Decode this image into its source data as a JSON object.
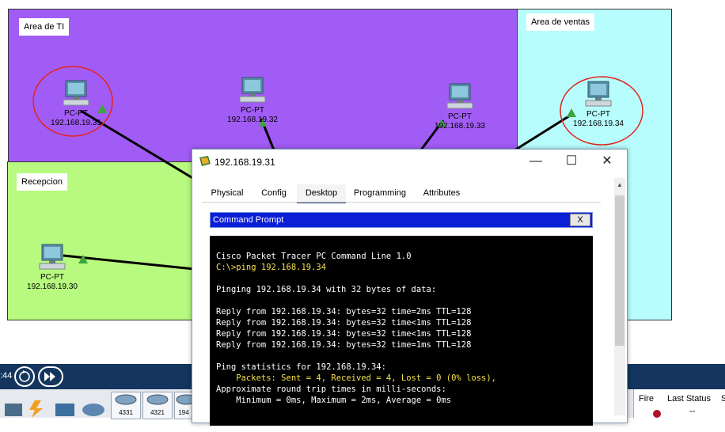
{
  "zones": {
    "ti": {
      "label": "Area de TI",
      "color": "#a25cf6"
    },
    "ventas": {
      "label": "Area de ventas",
      "color": "#b8fdfd"
    },
    "recepcion": {
      "label": "Recepcion",
      "color": "#b7fa7f"
    }
  },
  "devices": [
    {
      "type": "PC-PT",
      "ip": "192.168.19.31"
    },
    {
      "type": "PC-PT",
      "ip": "192.168.19.32"
    },
    {
      "type": "PC-PT",
      "ip": "192.168.19.33"
    },
    {
      "type": "PC-PT",
      "ip": "192.168.19.34"
    },
    {
      "type": "PC-PT",
      "ip": "192.168.19.30"
    }
  ],
  "window": {
    "title": "192.168.19.31",
    "tabs": [
      "Physical",
      "Config",
      "Desktop",
      "Programming",
      "Attributes"
    ],
    "active_tab": "Desktop",
    "cmd_title": "Command Prompt",
    "cmd_close": "X",
    "terminal_lines": [
      {
        "text": "Cisco Packet Tracer PC Command Line 1.0",
        "color": "white"
      },
      {
        "text": "C:\\>ping 192.168.19.34",
        "color": "yellow"
      },
      {
        "text": "",
        "color": "white"
      },
      {
        "text": "Pinging 192.168.19.34 with 32 bytes of data:",
        "color": "white"
      },
      {
        "text": "",
        "color": "white"
      },
      {
        "text": "Reply from 192.168.19.34: bytes=32 time=2ms TTL=128",
        "color": "white"
      },
      {
        "text": "Reply from 192.168.19.34: bytes=32 time<1ms TTL=128",
        "color": "white"
      },
      {
        "text": "Reply from 192.168.19.34: bytes=32 time<1ms TTL=128",
        "color": "white"
      },
      {
        "text": "Reply from 192.168.19.34: bytes=32 time=1ms TTL=128",
        "color": "white"
      },
      {
        "text": "",
        "color": "white"
      },
      {
        "text": "Ping statistics for 192.168.19.34:",
        "color": "white"
      },
      {
        "text": "    Packets: Sent = 4, Received = 4, Lost = 0 (0% loss),",
        "color": "yellow"
      },
      {
        "text": "Approximate round trip times in milli-seconds:",
        "color": "white"
      },
      {
        "text": "    Minimum = 0ms, Maximum = 2ms, Average = 0ms",
        "color": "white"
      }
    ]
  },
  "toolbar": {
    "time_fragment": ":44",
    "device_models": [
      "4331",
      "4321",
      "194"
    ],
    "event_columns": [
      "Fire",
      "Last Status",
      "S"
    ],
    "last_status_value": "--"
  },
  "colors": {
    "navy_bar": "#14365e",
    "cmd_header": "#0a1fd6",
    "annotation_red": "#e3241b",
    "link_green": "#3ca53c"
  }
}
